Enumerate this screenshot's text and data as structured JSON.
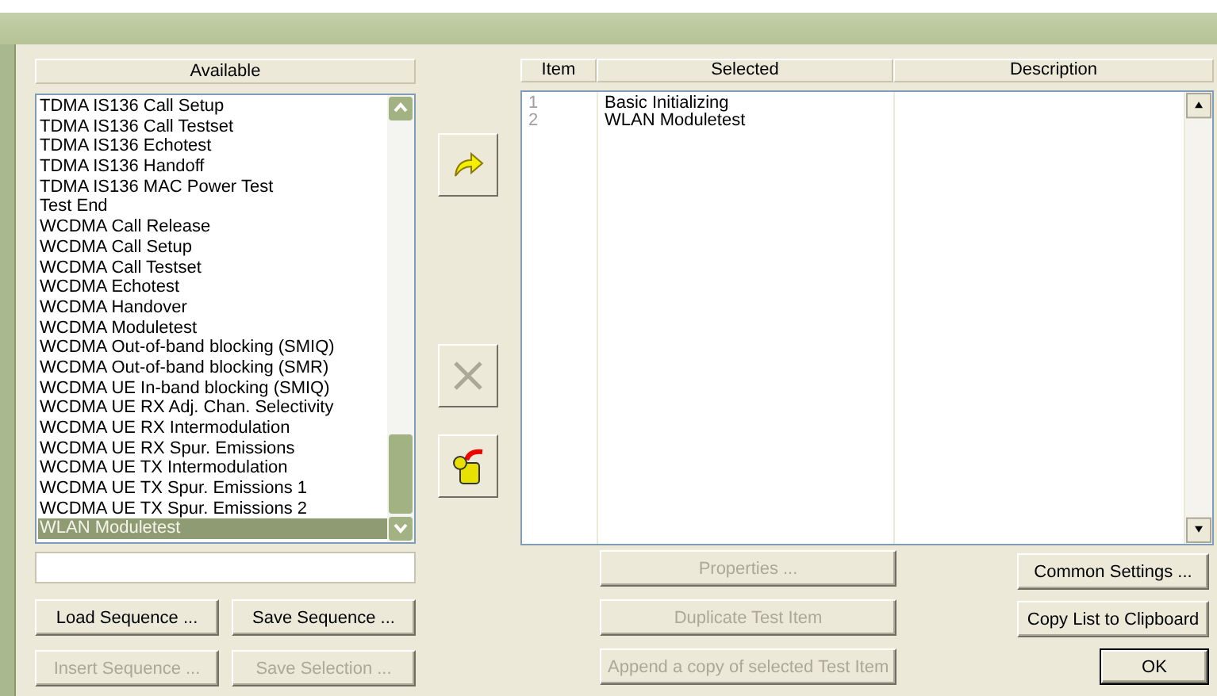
{
  "available": {
    "header": "Available",
    "items": [
      {
        "label": "TDMA IS136 Call Setup",
        "selected": false
      },
      {
        "label": "TDMA IS136 Call Testset",
        "selected": false
      },
      {
        "label": "TDMA IS136 Echotest",
        "selected": false
      },
      {
        "label": "TDMA IS136 Handoff",
        "selected": false
      },
      {
        "label": "TDMA IS136 MAC Power Test",
        "selected": false
      },
      {
        "label": "Test End",
        "selected": false
      },
      {
        "label": "WCDMA Call Release",
        "selected": false
      },
      {
        "label": "WCDMA Call Setup",
        "selected": false
      },
      {
        "label": "WCDMA Call Testset",
        "selected": false
      },
      {
        "label": "WCDMA Echotest",
        "selected": false
      },
      {
        "label": "WCDMA Handover",
        "selected": false
      },
      {
        "label": "WCDMA Moduletest",
        "selected": false
      },
      {
        "label": "WCDMA Out-of-band blocking (SMIQ)",
        "selected": false
      },
      {
        "label": "WCDMA Out-of-band blocking (SMR)",
        "selected": false
      },
      {
        "label": "WCDMA UE In-band blocking (SMIQ)",
        "selected": false
      },
      {
        "label": "WCDMA UE RX Adj. Chan. Selectivity",
        "selected": false
      },
      {
        "label": "WCDMA UE RX Intermodulation",
        "selected": false
      },
      {
        "label": "WCDMA UE RX Spur. Emissions",
        "selected": false
      },
      {
        "label": "WCDMA UE TX Intermodulation",
        "selected": false
      },
      {
        "label": "WCDMA UE TX Spur. Emissions 1",
        "selected": false
      },
      {
        "label": "WCDMA UE TX Spur. Emissions 2",
        "selected": false
      },
      {
        "label": "WLAN Moduletest",
        "selected": true
      }
    ],
    "buttons": [
      {
        "label": "Load Sequence ...",
        "disabled": false
      },
      {
        "label": "Save Sequence ...",
        "disabled": false
      },
      {
        "label": "Insert Sequence ...",
        "disabled": true
      },
      {
        "label": "Save Selection ...",
        "disabled": true
      }
    ]
  },
  "middle_buttons": [
    {
      "kind": "add",
      "disabled": false
    },
    {
      "kind": "remove",
      "disabled": true
    },
    {
      "kind": "oil",
      "disabled": false
    }
  ],
  "sequence": {
    "columns": [
      "Item",
      "Selected",
      "Description"
    ],
    "rows": [
      {
        "item": "1",
        "selected_name": "Basic Initializing"
      },
      {
        "item": "2",
        "selected_name": "WLAN Moduletest"
      }
    ],
    "left_buttons": [
      {
        "label": "Properties ...",
        "disabled": true
      },
      {
        "label": "Duplicate Test Item",
        "disabled": true
      },
      {
        "label": "Append a copy of selected Test Item",
        "disabled": true
      }
    ],
    "right_buttons": [
      {
        "label": "Common Settings ...",
        "disabled": false,
        "default": false
      },
      {
        "label": "Copy List to Clipboard",
        "disabled": false,
        "default": false
      },
      {
        "label": "OK",
        "disabled": false,
        "default": true
      }
    ]
  }
}
